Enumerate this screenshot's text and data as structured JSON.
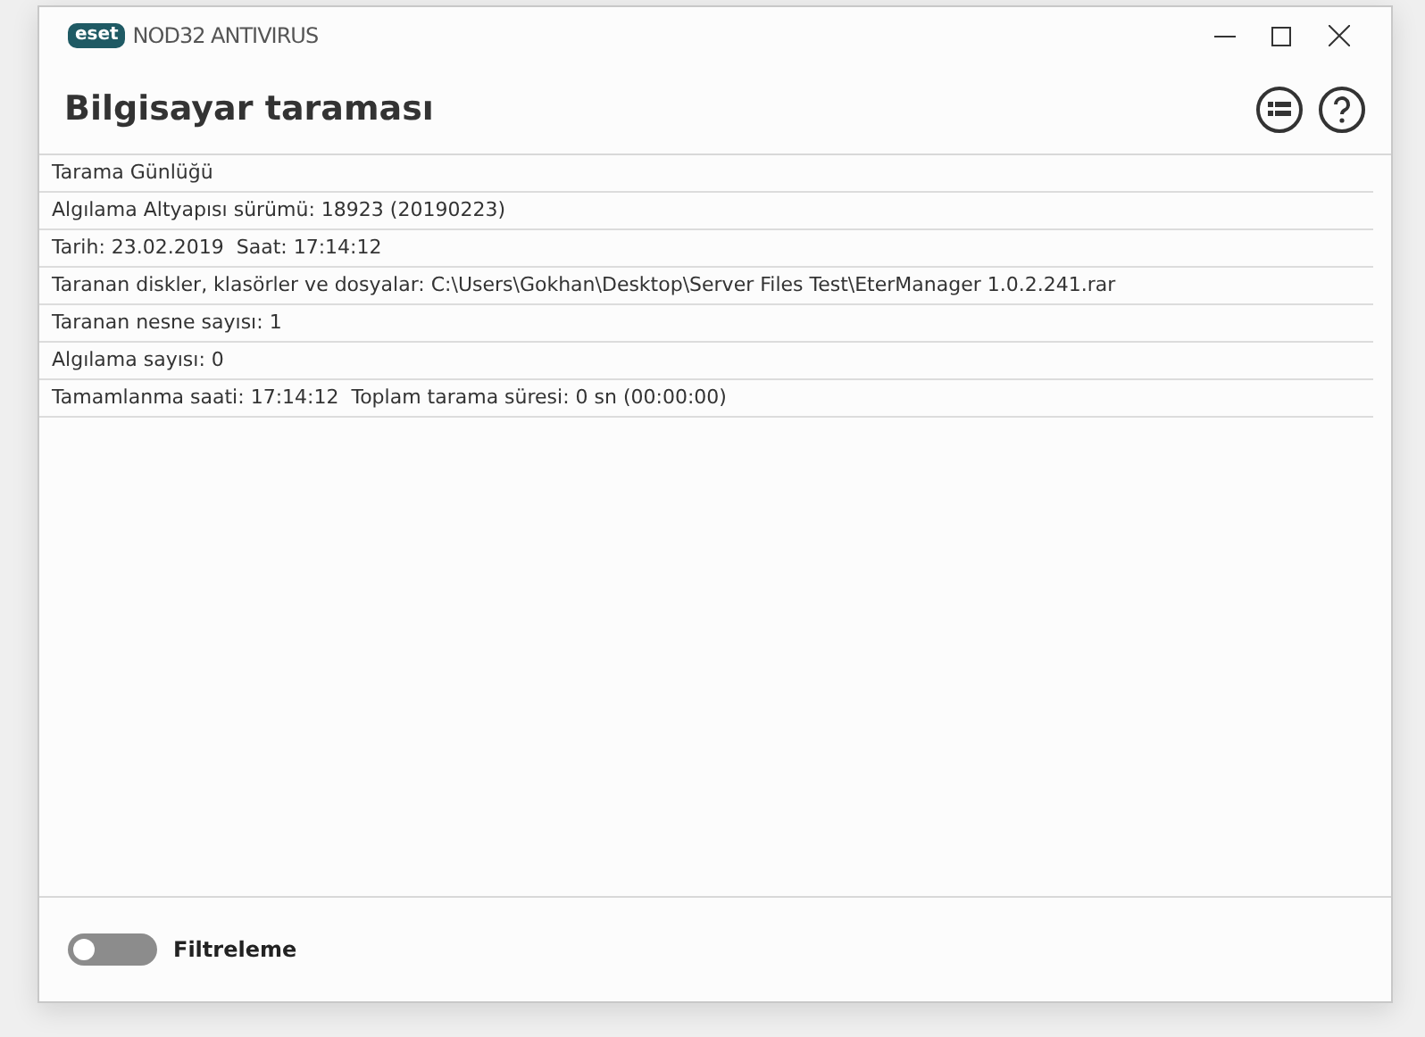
{
  "window": {
    "logo": "eset",
    "title": "NOD32 ANTIVIRUS"
  },
  "header": {
    "title": "Bilgisayar taraması"
  },
  "log": {
    "rows": [
      "Tarama Günlüğü",
      "Algılama Altyapısı sürümü: 18923 (20190223)",
      "Tarih: 23.02.2019  Saat: 17:14:12",
      "Taranan diskler, klasörler ve dosyalar: C:\\Users\\Gokhan\\Desktop\\Server Files Test\\EterManager 1.0.2.241.rar",
      "Taranan nesne sayısı: 1",
      "Algılama sayısı: 0",
      "Tamamlanma saati: 17:14:12  Toplam tarama süresi: 0 sn (00:00:00)"
    ]
  },
  "footer": {
    "filter": {
      "label": "Filtreleme",
      "on": false
    }
  }
}
